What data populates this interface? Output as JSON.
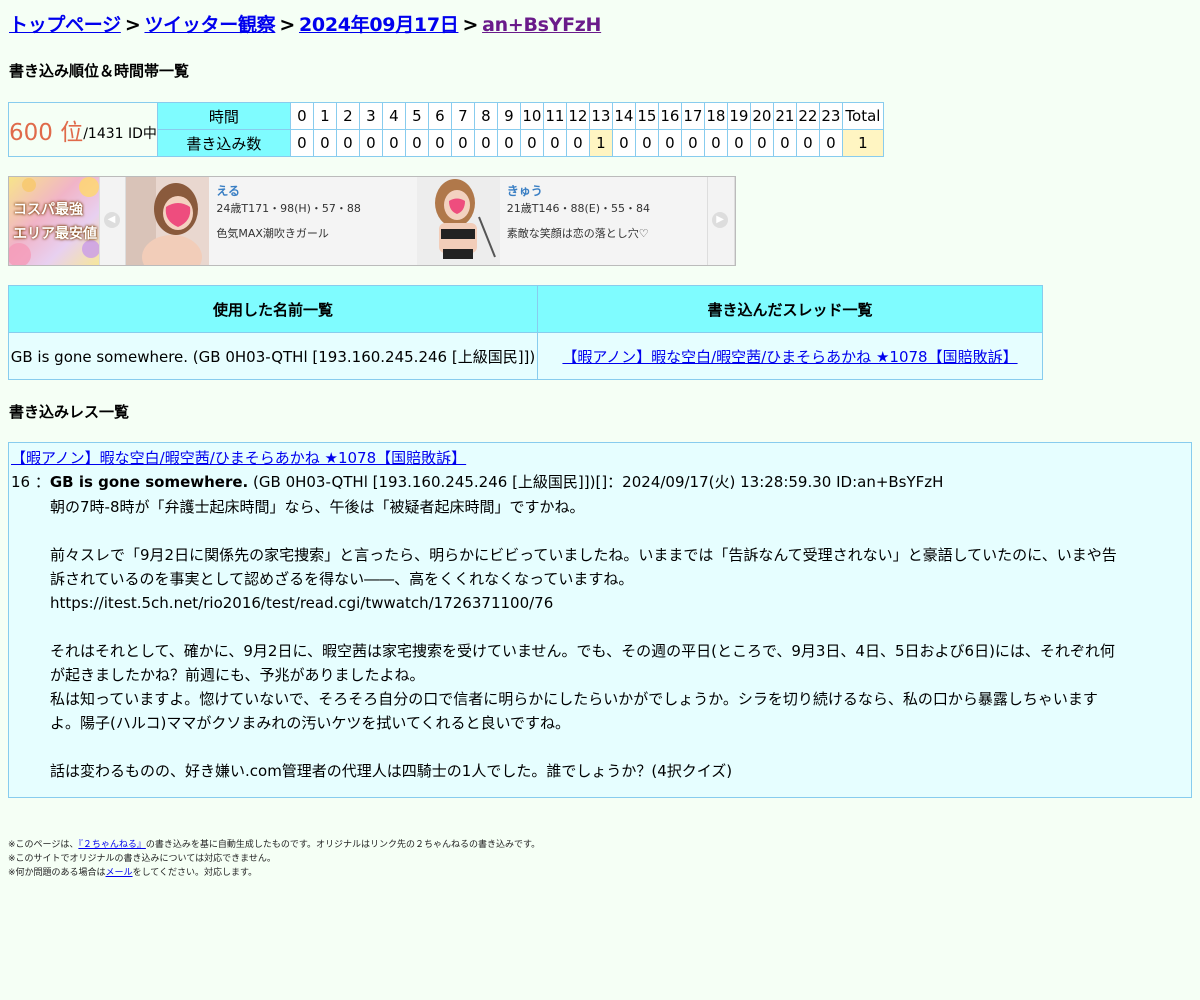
{
  "breadcrumb": {
    "home": "トップページ",
    "board": "ツイッター観察",
    "date": "2024年09月17日",
    "current": "an+BsYFzH",
    "separator": ">"
  },
  "rank_section": {
    "title": "書き込み順位＆時間帯一覧",
    "rank": "600 位",
    "rank_suffix": "/1431 ID中",
    "row_time_label": "時間",
    "row_count_label": "書き込み数",
    "hours": [
      "0",
      "1",
      "2",
      "3",
      "4",
      "5",
      "6",
      "7",
      "8",
      "9",
      "10",
      "11",
      "12",
      "13",
      "14",
      "15",
      "16",
      "17",
      "18",
      "19",
      "20",
      "21",
      "22",
      "23"
    ],
    "total_label": "Total",
    "counts": [
      "0",
      "0",
      "0",
      "0",
      "0",
      "0",
      "0",
      "0",
      "0",
      "0",
      "0",
      "0",
      "0",
      "1",
      "0",
      "0",
      "0",
      "0",
      "0",
      "0",
      "0",
      "0",
      "0",
      "0"
    ],
    "total": "1"
  },
  "ad": {
    "logo_line1": "コスパ最強",
    "logo_line2": "エリア最安値",
    "cards": [
      {
        "name": "える",
        "stats": "24歳T171・98(H)・57・88",
        "desc": "色気MAX潮吹きガール"
      },
      {
        "name": "きゅう",
        "stats": "21歳T146・88(E)・55・84",
        "desc": "素敵な笑顔は恋の落とし穴♡"
      }
    ],
    "prev_icon": "chevron-left-icon",
    "next_icon": "chevron-right-icon"
  },
  "lists": {
    "names_header": "使用した名前一覧",
    "threads_header": "書き込んだスレッド一覧",
    "name_value": "GB is gone somewhere. (GB 0H03-QTHl [193.160.245.246 [上級国民]])",
    "thread_value": "【暇アノン】暇な空白/暇空茜/ひまそらあかね ★1078【国賠敗訴】"
  },
  "posts_section": {
    "title": "書き込みレス一覧",
    "thread_link": "【暇アノン】暇な空白/暇空茜/ひまそらあかね ★1078【国賠敗訴】",
    "number": "16 ：",
    "author": "GB is gone somewhere.",
    "meta": " (GB 0H03-QTHl [193.160.245.246 [上級国民]])[]：2024/09/17(火) 13:28:59.30 ID:an+BsYFzH",
    "body": {
      "p1": "朝の7時-8時が「弁護士起床時間」なら、午後は「被疑者起床時間」ですかね。",
      "p2a": "前々スレで「9月2日に関係先の家宅捜索」と言ったら、明らかにビビっていましたね。いままでは「告訴なんて受理されない」と豪語していたのに、いまや告",
      "p2b": "訴されているのを事実として認めざるを得ない――、高をくくれなくなっていますね。",
      "p2c": "https://itest.5ch.net/rio2016/test/read.cgi/twwatch/1726371100/76",
      "p3a": "それはそれとして、確かに、9月2日に、暇空茜は家宅捜索を受けていません。でも、その週の平日(ところで、9月3日、4日、5日および6日)には、それぞれ何",
      "p3b": "が起きましたかね？前週にも、予兆がありましたよね。",
      "p3c": "私は知っていますよ。惚けていないで、そろそろ自分の口で信者に明らかにしたらいかがでしょうか。シラを切り続けるなら、私の口から暴露しちゃいます",
      "p3d": "よ。陽子(ハルコ)ママがクソまみれの汚いケツを拭いてくれると良いですね。",
      "p4": "話は変わるものの、好き嫌い.com管理者の代理人は四騎士の1人でした。誰でしょうか？(4択クイズ)"
    }
  },
  "footer": {
    "l1_pre": "※このページは、",
    "l1_link": "『２ちゃんねる』",
    "l1_post": "の書き込みを基に自動生成したものです。オリジナルはリンク先の２ちゃんねるの書き込みです。",
    "l2": "※このサイトでオリジナルの書き込みについては対応できません。",
    "l3_pre": "※何か問題のある場合は",
    "l3_link": "メール",
    "l3_post": "をしてください。対応します。"
  }
}
